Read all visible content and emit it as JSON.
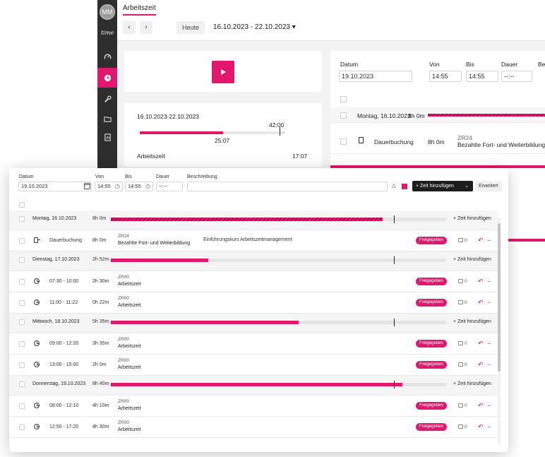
{
  "background": {
    "sidebar": {
      "avatar": "MM",
      "logo": "time"
    },
    "tab": "Arbeitszeit",
    "toolbar": {
      "prev": "‹",
      "next": "›",
      "today": "Heute",
      "range": "16.10.2023 - 22.10.2023 ▾"
    },
    "summary": {
      "range": "16.10.2023-22.10.2023",
      "target": "42:00",
      "actual": "25:07",
      "label": "Arbeitszeit",
      "value": "17:07"
    },
    "form": {
      "datum_label": "Datum",
      "von_label": "Von",
      "bis_label": "Bis",
      "dauer_label": "Dauer",
      "beschreibung_label": "Be",
      "datum": "19.10.2023",
      "von": "14:55",
      "bis": "14:55",
      "dauer": "--:--"
    },
    "rows": {
      "day": "Montag, 16.10.2023",
      "day_hours": "8h 0m",
      "entry_label": "Dauerbuchung",
      "entry_hours": "8h 0m",
      "entry_code": "ZR24",
      "entry_category": "Bezahlte Fort- und Weiterbildung"
    }
  },
  "form": {
    "datum_label": "Datum",
    "von_label": "Von",
    "bis_label": "Bis",
    "dauer_label": "Dauer",
    "beschreibung_label": "Beschreibung",
    "datum": "19.10.2023",
    "von": "14:55",
    "bis": "14:55",
    "dauer_placeholder": "--:--",
    "add_time_button": "+ Zeit hinzufügen",
    "erweitert_button": "Erweitert"
  },
  "days": [
    {
      "name": "Montag, 16.10.2023",
      "hours": "8h 0m",
      "progress": 0.81,
      "hatched": true,
      "add": "+ Zeit hinzufügen"
    },
    {
      "name": "Dienstag, 17.10.2023",
      "hours": "2h 52m",
      "progress": 0.29,
      "hatched": false,
      "add": "+ Zeit hinzufügen"
    },
    {
      "name": "Mittwoch, 18.10.2023",
      "hours": "5h 35m",
      "progress": 0.56,
      "hatched": false,
      "add": "+ Zeit hinzufügen"
    },
    {
      "name": "Donnerstag, 19.10.2023",
      "hours": "8h 40m",
      "progress": 0.87,
      "hatched": false,
      "add": "+ Zeit hinzufügen"
    }
  ],
  "entries": [
    {
      "time": "Dauerbuchung",
      "hours": "8h 0m",
      "code": "ZR24",
      "category": "Bezahlte Fort- und Weiterbildung",
      "description": "Einführungskurs Arbeitszeitmanagement",
      "status": "Freigegeben",
      "comments": "0"
    },
    {
      "time": "07:30 - 10:00",
      "hours": "2h 30m",
      "code": "ZR00",
      "category": "Arbeitszeit",
      "description": "",
      "status": "Freigegeben",
      "comments": "0"
    },
    {
      "time": "11:00 - 11:22",
      "hours": "0h 22m",
      "code": "ZR00",
      "category": "Arbeitszeit",
      "description": "",
      "status": "Freigegeben",
      "comments": "0"
    },
    {
      "time": "09:00 - 12:35",
      "hours": "3h 35m",
      "code": "ZR00",
      "category": "Arbeitszeit",
      "description": "",
      "status": "Freigegeben",
      "comments": "0"
    },
    {
      "time": "13:00 - 15:00",
      "hours": "2h 0m",
      "code": "ZR00",
      "category": "Arbeitszeit",
      "description": "",
      "status": "Freigegeben",
      "comments": "0"
    },
    {
      "time": "08:00 - 12:10",
      "hours": "4h 10m",
      "code": "ZR00",
      "category": "Arbeitszeit",
      "description": "",
      "status": "Freigegeben",
      "comments": "0"
    },
    {
      "time": "12:50 - 17:20",
      "hours": "4h 30m",
      "code": "ZR00",
      "category": "Arbeitszeit",
      "description": "",
      "status": "Freigegeben",
      "comments": "0"
    }
  ],
  "colors": {
    "accent": "#e2176e",
    "sidebar": "#2e2e2e",
    "button_dark": "#1d1d1d"
  }
}
